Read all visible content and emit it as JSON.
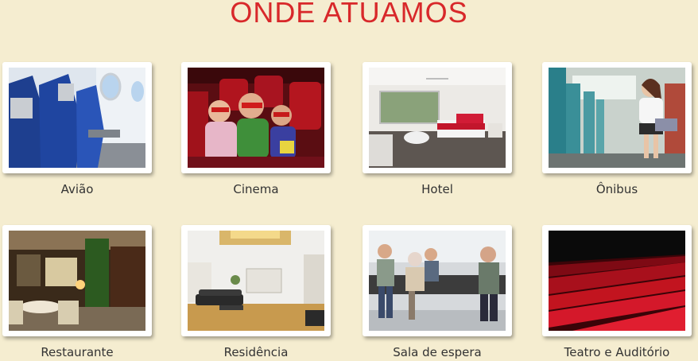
{
  "page": {
    "title": "ONDE ATUAMOS"
  },
  "locations": [
    {
      "label": "Avião",
      "icon": "airplane-cabin-photo"
    },
    {
      "label": "Cinema",
      "icon": "cinema-audience-photo"
    },
    {
      "label": "Hotel",
      "icon": "hotel-room-photo"
    },
    {
      "label": "Ônibus",
      "icon": "bus-interior-photo"
    },
    {
      "label": "Restaurante",
      "icon": "restaurant-interior-photo"
    },
    {
      "label": "Residência",
      "icon": "living-room-photo"
    },
    {
      "label": "Sala de espera",
      "icon": "waiting-room-photo"
    },
    {
      "label": "Teatro e Auditório",
      "icon": "theater-seats-photo"
    }
  ],
  "colors": {
    "title": "#d8282a",
    "background": "#f5edd0"
  }
}
